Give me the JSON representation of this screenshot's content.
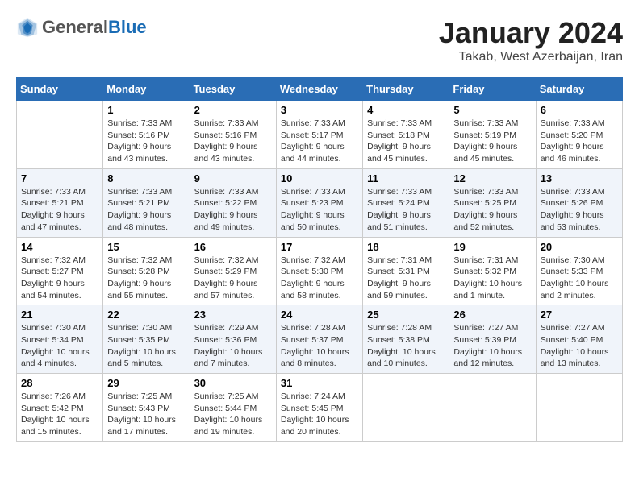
{
  "header": {
    "logo_general": "General",
    "logo_blue": "Blue",
    "month": "January 2024",
    "location": "Takab, West Azerbaijan, Iran"
  },
  "days_of_week": [
    "Sunday",
    "Monday",
    "Tuesday",
    "Wednesday",
    "Thursday",
    "Friday",
    "Saturday"
  ],
  "weeks": [
    [
      {
        "day": null,
        "info": null
      },
      {
        "day": "1",
        "info": "Sunrise: 7:33 AM\nSunset: 5:16 PM\nDaylight: 9 hours\nand 43 minutes."
      },
      {
        "day": "2",
        "info": "Sunrise: 7:33 AM\nSunset: 5:16 PM\nDaylight: 9 hours\nand 43 minutes."
      },
      {
        "day": "3",
        "info": "Sunrise: 7:33 AM\nSunset: 5:17 PM\nDaylight: 9 hours\nand 44 minutes."
      },
      {
        "day": "4",
        "info": "Sunrise: 7:33 AM\nSunset: 5:18 PM\nDaylight: 9 hours\nand 45 minutes."
      },
      {
        "day": "5",
        "info": "Sunrise: 7:33 AM\nSunset: 5:19 PM\nDaylight: 9 hours\nand 45 minutes."
      },
      {
        "day": "6",
        "info": "Sunrise: 7:33 AM\nSunset: 5:20 PM\nDaylight: 9 hours\nand 46 minutes."
      }
    ],
    [
      {
        "day": "7",
        "info": "Sunrise: 7:33 AM\nSunset: 5:21 PM\nDaylight: 9 hours\nand 47 minutes."
      },
      {
        "day": "8",
        "info": "Sunrise: 7:33 AM\nSunset: 5:21 PM\nDaylight: 9 hours\nand 48 minutes."
      },
      {
        "day": "9",
        "info": "Sunrise: 7:33 AM\nSunset: 5:22 PM\nDaylight: 9 hours\nand 49 minutes."
      },
      {
        "day": "10",
        "info": "Sunrise: 7:33 AM\nSunset: 5:23 PM\nDaylight: 9 hours\nand 50 minutes."
      },
      {
        "day": "11",
        "info": "Sunrise: 7:33 AM\nSunset: 5:24 PM\nDaylight: 9 hours\nand 51 minutes."
      },
      {
        "day": "12",
        "info": "Sunrise: 7:33 AM\nSunset: 5:25 PM\nDaylight: 9 hours\nand 52 minutes."
      },
      {
        "day": "13",
        "info": "Sunrise: 7:33 AM\nSunset: 5:26 PM\nDaylight: 9 hours\nand 53 minutes."
      }
    ],
    [
      {
        "day": "14",
        "info": "Sunrise: 7:32 AM\nSunset: 5:27 PM\nDaylight: 9 hours\nand 54 minutes."
      },
      {
        "day": "15",
        "info": "Sunrise: 7:32 AM\nSunset: 5:28 PM\nDaylight: 9 hours\nand 55 minutes."
      },
      {
        "day": "16",
        "info": "Sunrise: 7:32 AM\nSunset: 5:29 PM\nDaylight: 9 hours\nand 57 minutes."
      },
      {
        "day": "17",
        "info": "Sunrise: 7:32 AM\nSunset: 5:30 PM\nDaylight: 9 hours\nand 58 minutes."
      },
      {
        "day": "18",
        "info": "Sunrise: 7:31 AM\nSunset: 5:31 PM\nDaylight: 9 hours\nand 59 minutes."
      },
      {
        "day": "19",
        "info": "Sunrise: 7:31 AM\nSunset: 5:32 PM\nDaylight: 10 hours\nand 1 minute."
      },
      {
        "day": "20",
        "info": "Sunrise: 7:30 AM\nSunset: 5:33 PM\nDaylight: 10 hours\nand 2 minutes."
      }
    ],
    [
      {
        "day": "21",
        "info": "Sunrise: 7:30 AM\nSunset: 5:34 PM\nDaylight: 10 hours\nand 4 minutes."
      },
      {
        "day": "22",
        "info": "Sunrise: 7:30 AM\nSunset: 5:35 PM\nDaylight: 10 hours\nand 5 minutes."
      },
      {
        "day": "23",
        "info": "Sunrise: 7:29 AM\nSunset: 5:36 PM\nDaylight: 10 hours\nand 7 minutes."
      },
      {
        "day": "24",
        "info": "Sunrise: 7:28 AM\nSunset: 5:37 PM\nDaylight: 10 hours\nand 8 minutes."
      },
      {
        "day": "25",
        "info": "Sunrise: 7:28 AM\nSunset: 5:38 PM\nDaylight: 10 hours\nand 10 minutes."
      },
      {
        "day": "26",
        "info": "Sunrise: 7:27 AM\nSunset: 5:39 PM\nDaylight: 10 hours\nand 12 minutes."
      },
      {
        "day": "27",
        "info": "Sunrise: 7:27 AM\nSunset: 5:40 PM\nDaylight: 10 hours\nand 13 minutes."
      }
    ],
    [
      {
        "day": "28",
        "info": "Sunrise: 7:26 AM\nSunset: 5:42 PM\nDaylight: 10 hours\nand 15 minutes."
      },
      {
        "day": "29",
        "info": "Sunrise: 7:25 AM\nSunset: 5:43 PM\nDaylight: 10 hours\nand 17 minutes."
      },
      {
        "day": "30",
        "info": "Sunrise: 7:25 AM\nSunset: 5:44 PM\nDaylight: 10 hours\nand 19 minutes."
      },
      {
        "day": "31",
        "info": "Sunrise: 7:24 AM\nSunset: 5:45 PM\nDaylight: 10 hours\nand 20 minutes."
      },
      {
        "day": null,
        "info": null
      },
      {
        "day": null,
        "info": null
      },
      {
        "day": null,
        "info": null
      }
    ]
  ]
}
